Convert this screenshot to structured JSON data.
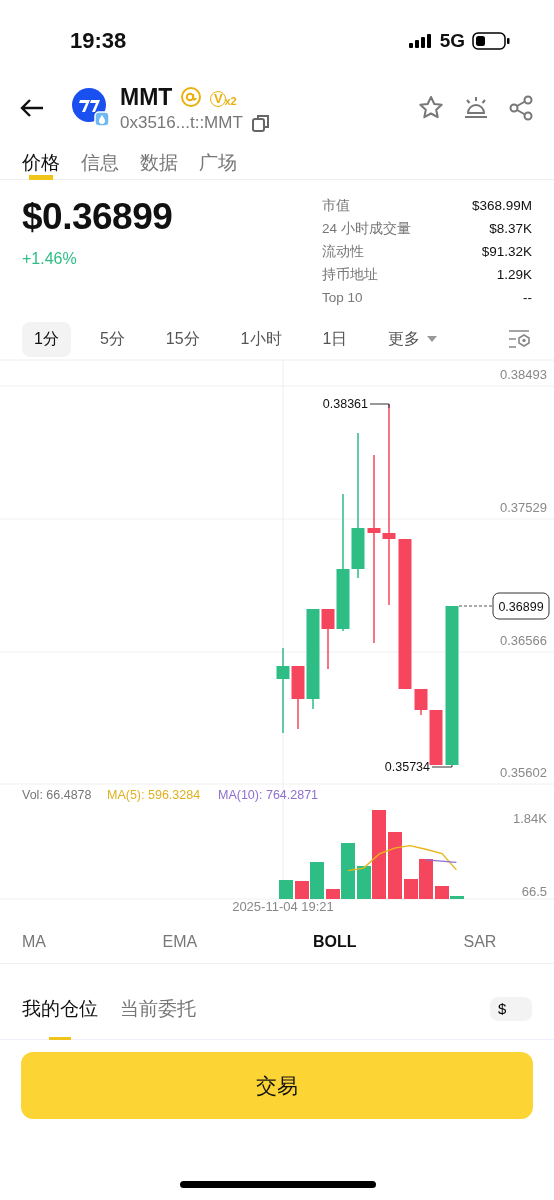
{
  "status_bar": {
    "time": "19:38",
    "network": "5G"
  },
  "header": {
    "symbol": "MMT",
    "badge_letter": "V",
    "badge_multiplier": "x2",
    "address": "0x3516...t::MMT"
  },
  "tabs": [
    {
      "label": "价格",
      "selected": true
    },
    {
      "label": "信息",
      "selected": false
    },
    {
      "label": "数据",
      "selected": false
    },
    {
      "label": "广场",
      "selected": false
    }
  ],
  "price": {
    "value": "$0.36899",
    "change": "+1.46%"
  },
  "stats": [
    {
      "label": "市值",
      "value": "$368.99M"
    },
    {
      "label": "24 小时成交量",
      "value": "$8.37K"
    },
    {
      "label": "流动性",
      "value": "$91.32K"
    },
    {
      "label": "持币地址",
      "value": "1.29K"
    },
    {
      "label": "Top 10",
      "value": "--"
    }
  ],
  "intervals": [
    {
      "label": "1分",
      "selected": true,
      "kind": "plain"
    },
    {
      "label": "5分",
      "selected": false,
      "kind": "plain"
    },
    {
      "label": "15分",
      "selected": false,
      "kind": "plain"
    },
    {
      "label": "1小时",
      "selected": false,
      "kind": "plain"
    },
    {
      "label": "1日",
      "selected": false,
      "kind": "plain"
    },
    {
      "label": "更多",
      "selected": false,
      "kind": "dropdown"
    }
  ],
  "chart": {
    "y_labels": [
      "0.38493",
      "0.37529",
      "0.36566",
      "0.35602"
    ],
    "high_label": "0.38361",
    "low_label": "0.35734",
    "last_price": "0.36899",
    "volume_legend": {
      "vol": "Vol: 66.4878",
      "ma5": "MA(5): 596.3284",
      "ma10": "MA(10): 764.2871"
    },
    "volume_labels": [
      "1.84K",
      "66.5"
    ],
    "time_label": "2025-11-04 19:21"
  },
  "indicators": [
    {
      "label": "MA",
      "selected": false
    },
    {
      "label": "EMA",
      "selected": false
    },
    {
      "label": "BOLL",
      "selected": true
    },
    {
      "label": "SAR",
      "selected": false
    }
  ],
  "position_tabs": [
    {
      "label": "我的仓位",
      "selected": true
    },
    {
      "label": "当前委托",
      "selected": false
    }
  ],
  "currency_toggle": "$",
  "trade_button": "交易"
}
